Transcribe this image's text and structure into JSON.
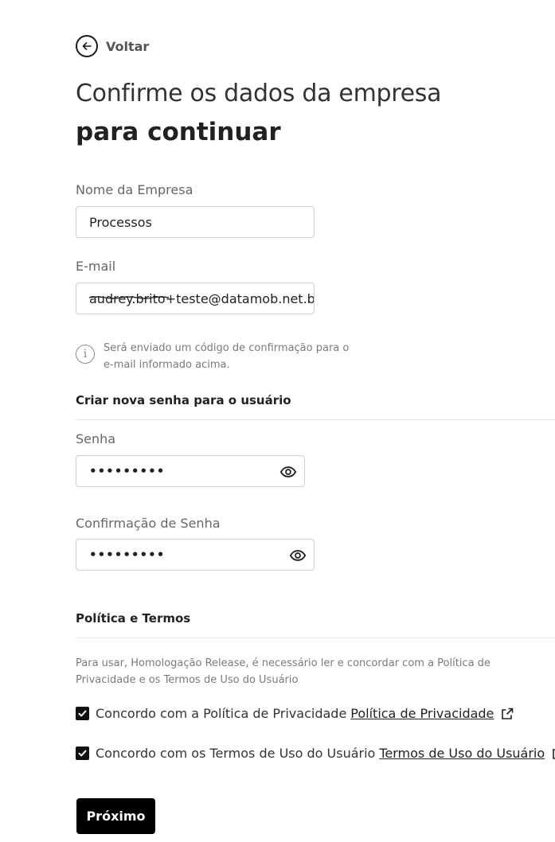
{
  "back": {
    "label": "Voltar",
    "icon": "arrow-left-icon"
  },
  "title": {
    "line1": "Confirme os dados da empresa",
    "line2": "para continuar"
  },
  "company": {
    "label": "Nome da Empresa",
    "value": "Processos"
  },
  "email": {
    "label": "E-mail",
    "value_struck": "audrey.brito",
    "value_rest": "+teste@datamob.net.br",
    "info": "Será enviado um código de confirmação para o e-mail informado acima."
  },
  "password_section": {
    "title": "Criar nova senha para o usuário",
    "password_label": "Senha",
    "password_value": "•••••••••",
    "confirm_label": "Confirmação de Senha",
    "confirm_value": "•••••••••"
  },
  "terms": {
    "title": "Política e Termos",
    "description": "Para usar, Homologação Release, é necessário ler e concordar com a Política de Privacidade e os Termos de Uso do Usuário",
    "privacy": {
      "text": "Concordo com a Política de Privacidade",
      "link": "Política de Privacidade",
      "checked": true
    },
    "usage": {
      "text": "Concordo com os Termos de Uso do Usuário",
      "link": "Termos de Uso do Usuário",
      "checked": true
    }
  },
  "next_button": "Próximo"
}
